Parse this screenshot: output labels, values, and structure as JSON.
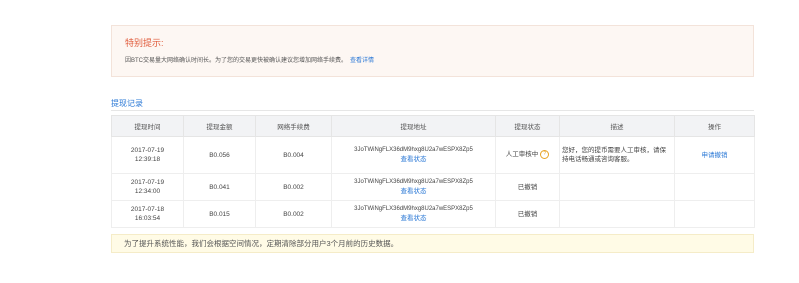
{
  "notice": {
    "title": "特别提示:",
    "text": "因BTC交易量大网络确认时间长。为了您的交易更快被确认建议您增加网络手续费。",
    "link": "查看详情"
  },
  "section_title": "提现记录",
  "table": {
    "headers": [
      "提现时间",
      "提现金额",
      "网络手续费",
      "提现地址",
      "提现状态",
      "描述",
      "操作"
    ],
    "rows": [
      {
        "date": "2017-07-19",
        "time": "12:39:18",
        "amount": "B0.056",
        "fee": "B0.004",
        "address": "3JoTWiNgFLX36dM9hxg8U2a7wESPX8Zp5",
        "address_link": "查看状态",
        "status": "人工审核中",
        "description": "您好，您的提币需要人工审核，请保持电话畅通或咨询客服。",
        "action": "申请撤销"
      },
      {
        "date": "2017-07-19",
        "time": "12:34:00",
        "amount": "B0.041",
        "fee": "B0.002",
        "address": "3JoTWiNgFLX36dM9hxg8U2a7wESPX8Zp5",
        "address_link": "查看状态",
        "status": "已撤销",
        "description": "",
        "action": ""
      },
      {
        "date": "2017-07-18",
        "time": "16:03:54",
        "amount": "B0.015",
        "fee": "B0.002",
        "address": "3JoTWiNgFLX36dM9hxg8U2a7wESPX8Zp5",
        "address_link": "查看状态",
        "status": "已撤销",
        "description": "",
        "action": ""
      }
    ]
  },
  "footer_note": "为了提升系统性能，我们会根据空间情况，定期清除部分用户3个月前的历史数据。",
  "colors": {
    "link": "#2a78d6",
    "notice_title": "#e05a3a",
    "help_icon": "#e8a325"
  },
  "icons": {
    "status_help": "question-circle-icon"
  }
}
